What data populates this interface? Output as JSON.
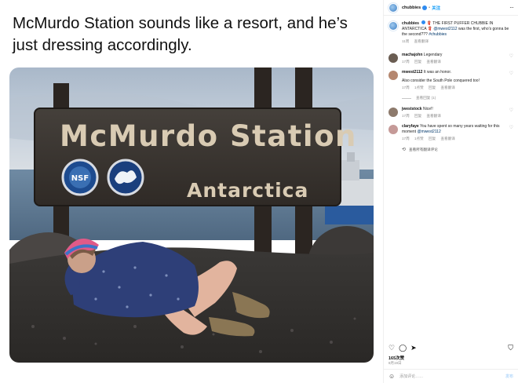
{
  "post": {
    "caption": "McMurdo Station sounds like a resort, and he’s just dressing accordingly.",
    "sign_title": "McMurdo Station",
    "sign_subtitle": "Antarctica",
    "nsf_label": "NSF"
  },
  "sidebar": {
    "header": {
      "username": "chubbies",
      "dot": "•",
      "follow": "关注",
      "more": "···"
    },
    "author_caption": {
      "username": "chubbies",
      "text_a": "🧣 THE FIRST PUFFER CHUBBIE IN ANTARCTICA 🧣 ",
      "mention": "@mwest2112",
      "text_b": " was the first, who's gonna be the second??? ",
      "hashtag": "#chubbies",
      "meta": [
        "11周",
        "查看翻译"
      ]
    },
    "comments": [
      {
        "username": "machajohn",
        "text": "Legendary",
        "meta": [
          "17周",
          "回复",
          "查看翻译"
        ]
      },
      {
        "username": "mwest2112",
        "text": "It was an honor.",
        "meta": [
          "17周",
          "1点赞",
          "回复",
          "查看翻译"
        ]
      },
      {
        "username": "jweststock",
        "text": "Nice!!",
        "meta": [
          "17周",
          "回复",
          "查看翻译"
        ]
      },
      {
        "username": "claryfaye",
        "text": "You have spent so many years waiting for this moment ",
        "mention": "@mwest2112",
        "meta": [
          "17周",
          "1点赞",
          "回复",
          "查看翻译"
        ]
      }
    ],
    "extra_line": "Also consider the South Pole conquered too!",
    "extra_meta": [
      "17周",
      "1点赞",
      "回复",
      "查看翻译"
    ],
    "replies_label": "查看回复 (1)",
    "translate_all": "查看所有翻译评论",
    "likes": "165次赞",
    "date": "8月19日",
    "add_comment_placeholder": "添加评论……",
    "post_label": "发布"
  },
  "colors": {
    "link": "#00376b",
    "follow": "#0095f6",
    "sign_bg": "#3c3530",
    "sign_text": "#d9cbb3"
  }
}
